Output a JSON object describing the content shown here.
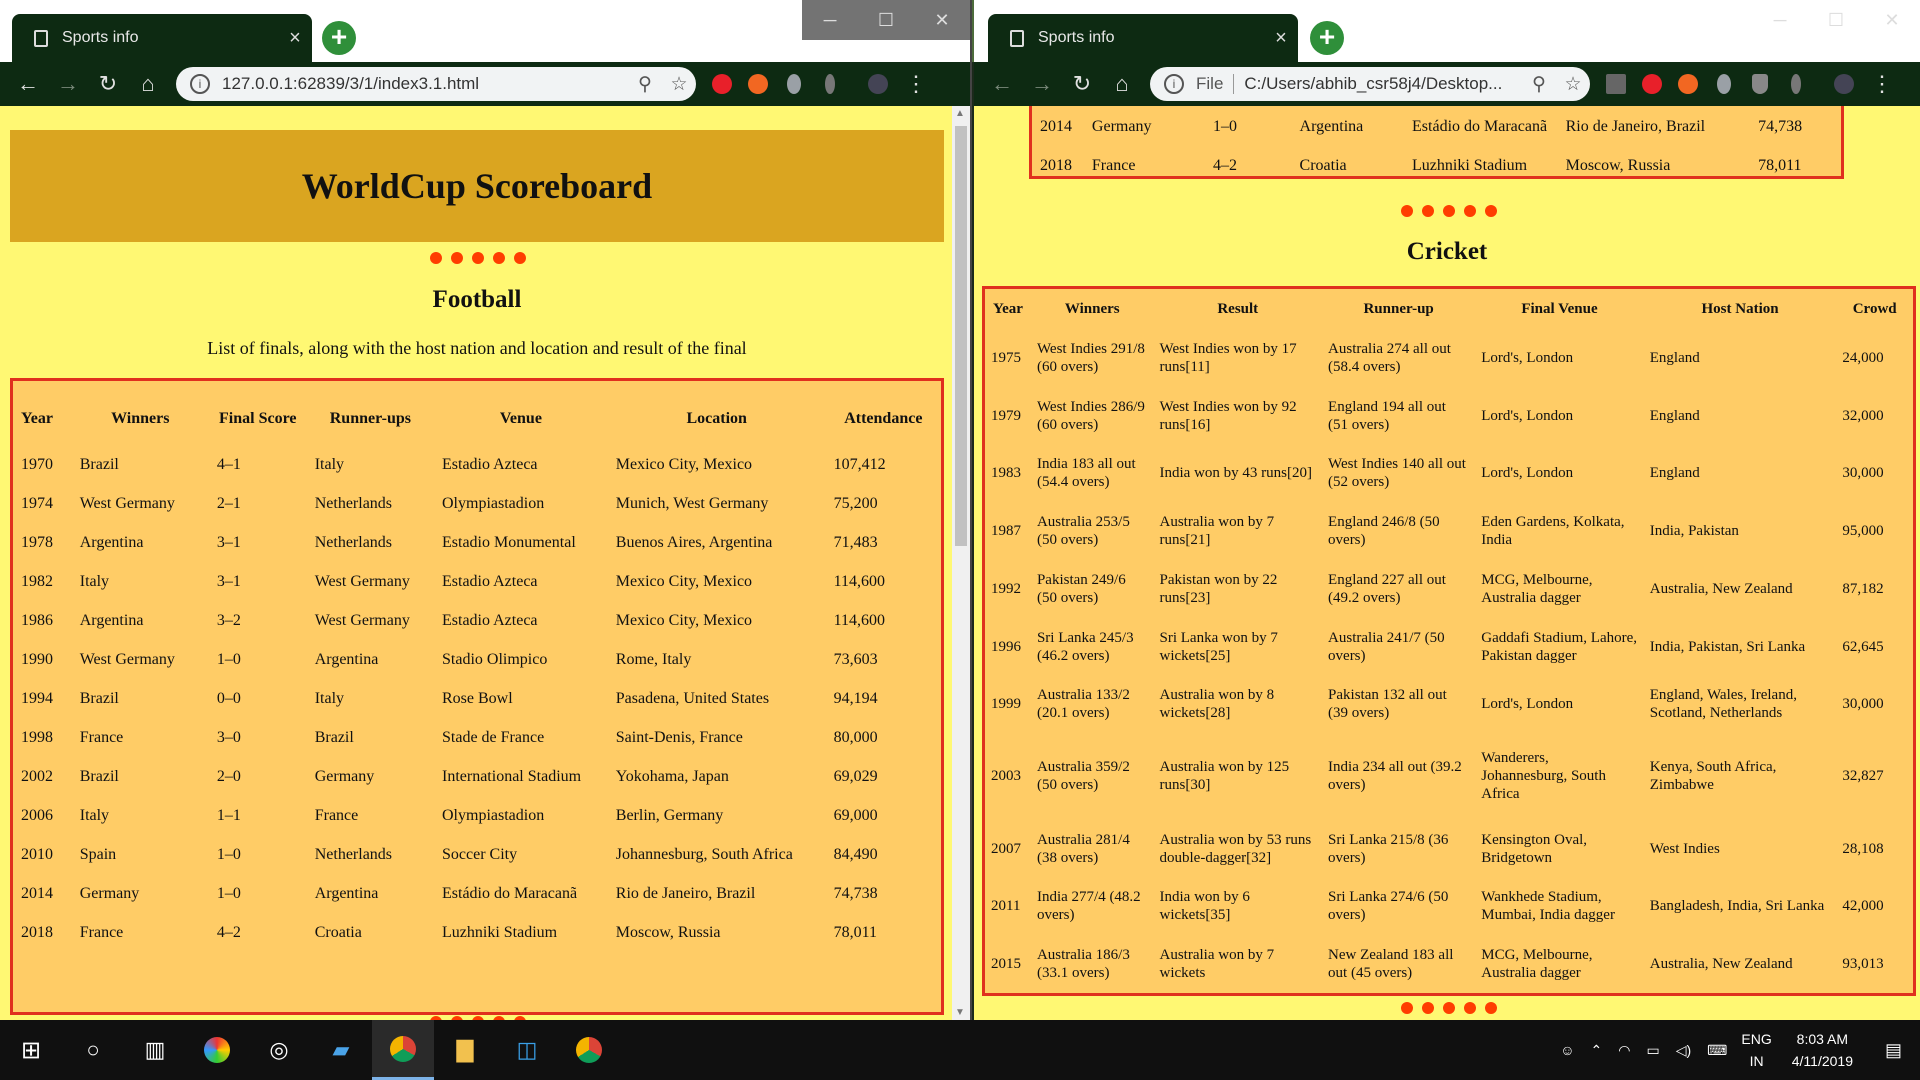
{
  "left_window": {
    "tab_title": "Sports info",
    "url": "127.0.0.1:62839/3/1/index3.1.html",
    "page_title": "WorldCup Scoreboard",
    "football": {
      "title": "Football",
      "description": "List of finals, along with the host nation and location and result of the final",
      "headers": [
        "Year",
        "Winners",
        "Final Score",
        "Runner-ups",
        "Venue",
        "Location",
        "Attendance"
      ],
      "rows": [
        [
          "1970",
          "Brazil",
          "4–1",
          "Italy",
          "Estadio Azteca",
          "Mexico City, Mexico",
          "107,412"
        ],
        [
          "1974",
          "West Germany",
          "2–1",
          "Netherlands",
          "Olympiastadion",
          "Munich, West Germany",
          "75,200"
        ],
        [
          "1978",
          "Argentina",
          "3–1",
          "Netherlands",
          "Estadio Monumental",
          "Buenos Aires, Argentina",
          "71,483"
        ],
        [
          "1982",
          "Italy",
          "3–1",
          "West Germany",
          "Estadio Azteca",
          "Mexico City, Mexico",
          "114,600"
        ],
        [
          "1986",
          "Argentina",
          "3–2",
          "West Germany",
          "Estadio Azteca",
          "Mexico City, Mexico",
          "114,600"
        ],
        [
          "1990",
          "West Germany",
          "1–0",
          "Argentina",
          "Stadio Olimpico",
          "Rome, Italy",
          "73,603"
        ],
        [
          "1994",
          "Brazil",
          "0–0",
          "Italy",
          "Rose Bowl",
          "Pasadena, United States",
          "94,194"
        ],
        [
          "1998",
          "France",
          "3–0",
          "Brazil",
          "Stade de France",
          "Saint-Denis, France",
          "80,000"
        ],
        [
          "2002",
          "Brazil",
          "2–0",
          "Germany",
          "International Stadium",
          "Yokohama, Japan",
          "69,029"
        ],
        [
          "2006",
          "Italy",
          "1–1",
          "France",
          "Olympiastadion",
          "Berlin, Germany",
          "69,000"
        ],
        [
          "2010",
          "Spain",
          "1–0",
          "Netherlands",
          "Soccer City",
          "Johannesburg, South Africa",
          "84,490"
        ],
        [
          "2014",
          "Germany",
          "1–0",
          "Argentina",
          "Estádio do Maracanã",
          "Rio de Janeiro, Brazil",
          "74,738"
        ],
        [
          "2018",
          "France",
          "4–2",
          "Croatia",
          "Luzhniki Stadium",
          "Moscow, Russia",
          "78,011"
        ]
      ]
    }
  },
  "right_window": {
    "tab_title": "Sports info",
    "url_prefix": "File",
    "url": "C:/Users/abhib_csr58j4/Desktop...",
    "football_tail_rows": [
      [
        "2014",
        "Germany",
        "1–0",
        "Argentina",
        "Estádio do Maracanã",
        "Rio de Janeiro, Brazil",
        "74,738"
      ],
      [
        "2018",
        "France",
        "4–2",
        "Croatia",
        "Luzhniki Stadium",
        "Moscow, Russia",
        "78,011"
      ]
    ],
    "cricket": {
      "title": "Cricket",
      "headers": [
        "Year",
        "Winners",
        "Result",
        "Runner-up",
        "Final Venue",
        "Host Nation",
        "Crowd"
      ],
      "rows": [
        [
          "1975",
          "West Indies 291/8 (60 overs)",
          "West Indies won by 17 runs[11]",
          "Australia 274 all out (58.4 overs)",
          "Lord's, London",
          "England",
          "24,000"
        ],
        [
          "1979",
          "West Indies 286/9 (60 overs)",
          "West Indies won by 92 runs[16]",
          "England 194 all out (51 overs)",
          "Lord's, London",
          "England",
          "32,000"
        ],
        [
          "1983",
          "India 183 all out (54.4 overs)",
          "India won by 43 runs[20]",
          "West Indies 140 all out (52 overs)",
          "Lord's, London",
          "England",
          "30,000"
        ],
        [
          "1987",
          "Australia 253/5 (50 overs)",
          "Australia won by 7 runs[21]",
          "England 246/8 (50 overs)",
          "Eden Gardens, Kolkata, India",
          "India, Pakistan",
          "95,000"
        ],
        [
          "1992",
          "Pakistan 249/6 (50 overs)",
          "Pakistan won by 22 runs[23]",
          "England 227 all out (49.2 overs)",
          "MCG, Melbourne, Australia dagger",
          "Australia, New Zealand",
          "87,182"
        ],
        [
          "1996",
          "Sri Lanka 245/3 (46.2 overs)",
          "Sri Lanka won by 7 wickets[25]",
          "Australia 241/7 (50 overs)",
          "Gaddafi Stadium, Lahore, Pakistan dagger",
          "India, Pakistan, Sri Lanka",
          "62,645"
        ],
        [
          "1999",
          "Australia 133/2 (20.1 overs)",
          "Australia won by 8 wickets[28]",
          "Pakistan 132 all out (39 overs)",
          "Lord's, London",
          "England, Wales, Ireland, Scotland, Netherlands",
          "30,000"
        ],
        [
          "2003",
          "Australia 359/2 (50 overs)",
          "Australia won by 125 runs[30]",
          "India 234 all out (39.2 overs)",
          "Wanderers, Johannesburg, South Africa",
          "Kenya, South Africa, Zimbabwe",
          "32,827"
        ],
        [
          "2007",
          "Australia 281/4 (38 overs)",
          "Australia won by 53 runs double-dagger[32]",
          "Sri Lanka 215/8 (36 overs)",
          "Kensington Oval, Bridgetown",
          "West Indies",
          "28,108"
        ],
        [
          "2011",
          "India 277/4 (48.2 overs)",
          "India won by 6 wickets[35]",
          "Sri Lanka 274/6 (50 overs)",
          "Wankhede Stadium, Mumbai, India dagger",
          "Bangladesh, India, Sri Lanka",
          "42,000"
        ],
        [
          "2015",
          "Australia 186/3 (33.1 overs)",
          "Australia won by 7 wickets",
          "New Zealand 183 all out (45 overs)",
          "MCG, Melbourne, Australia dagger",
          "Australia, New Zealand",
          "93,013"
        ]
      ]
    }
  },
  "taskbar": {
    "lang_top": "ENG",
    "lang_bottom": "IN",
    "time": "8:03 AM",
    "date": "4/11/2019"
  },
  "colors": {
    "page_bg": "#fff873",
    "header_bg": "#daa520",
    "table_bg": "#ffcc66",
    "table_border": "#e0301e",
    "dot_color": "#ff3d00"
  }
}
